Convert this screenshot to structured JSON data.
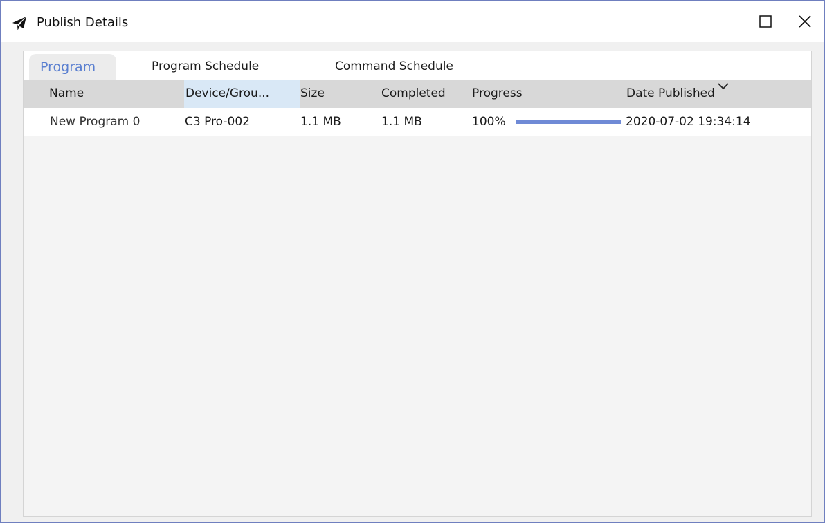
{
  "window": {
    "title": "Publish Details",
    "icon": "paper-plane-icon",
    "maximize_icon": "maximize-icon",
    "close_icon": "close-icon"
  },
  "tabs": [
    {
      "label": "Program",
      "active": true
    },
    {
      "label": "Program Schedule",
      "active": false
    },
    {
      "label": "Command Schedule",
      "active": false
    }
  ],
  "table": {
    "columns": [
      "Name",
      "Device/Grou...",
      "Size",
      "Completed",
      "Progress",
      "Date Published"
    ],
    "sort_icon": "chevron-down-icon",
    "rows": [
      {
        "name": "New Program 0",
        "device": "C3 Pro-002",
        "size": "1.1 MB",
        "completed": "1.1 MB",
        "progress_text": "100%",
        "progress_value": 1.0,
        "date_published": "2020-07-02 19:34:14"
      }
    ]
  },
  "colors": {
    "accent": "#5a7fd0",
    "progress": "#6f8ad6",
    "header_bg": "#d8d8d8",
    "selected_header_bg": "#d9e8f6",
    "window_border": "#6f7fbf"
  }
}
